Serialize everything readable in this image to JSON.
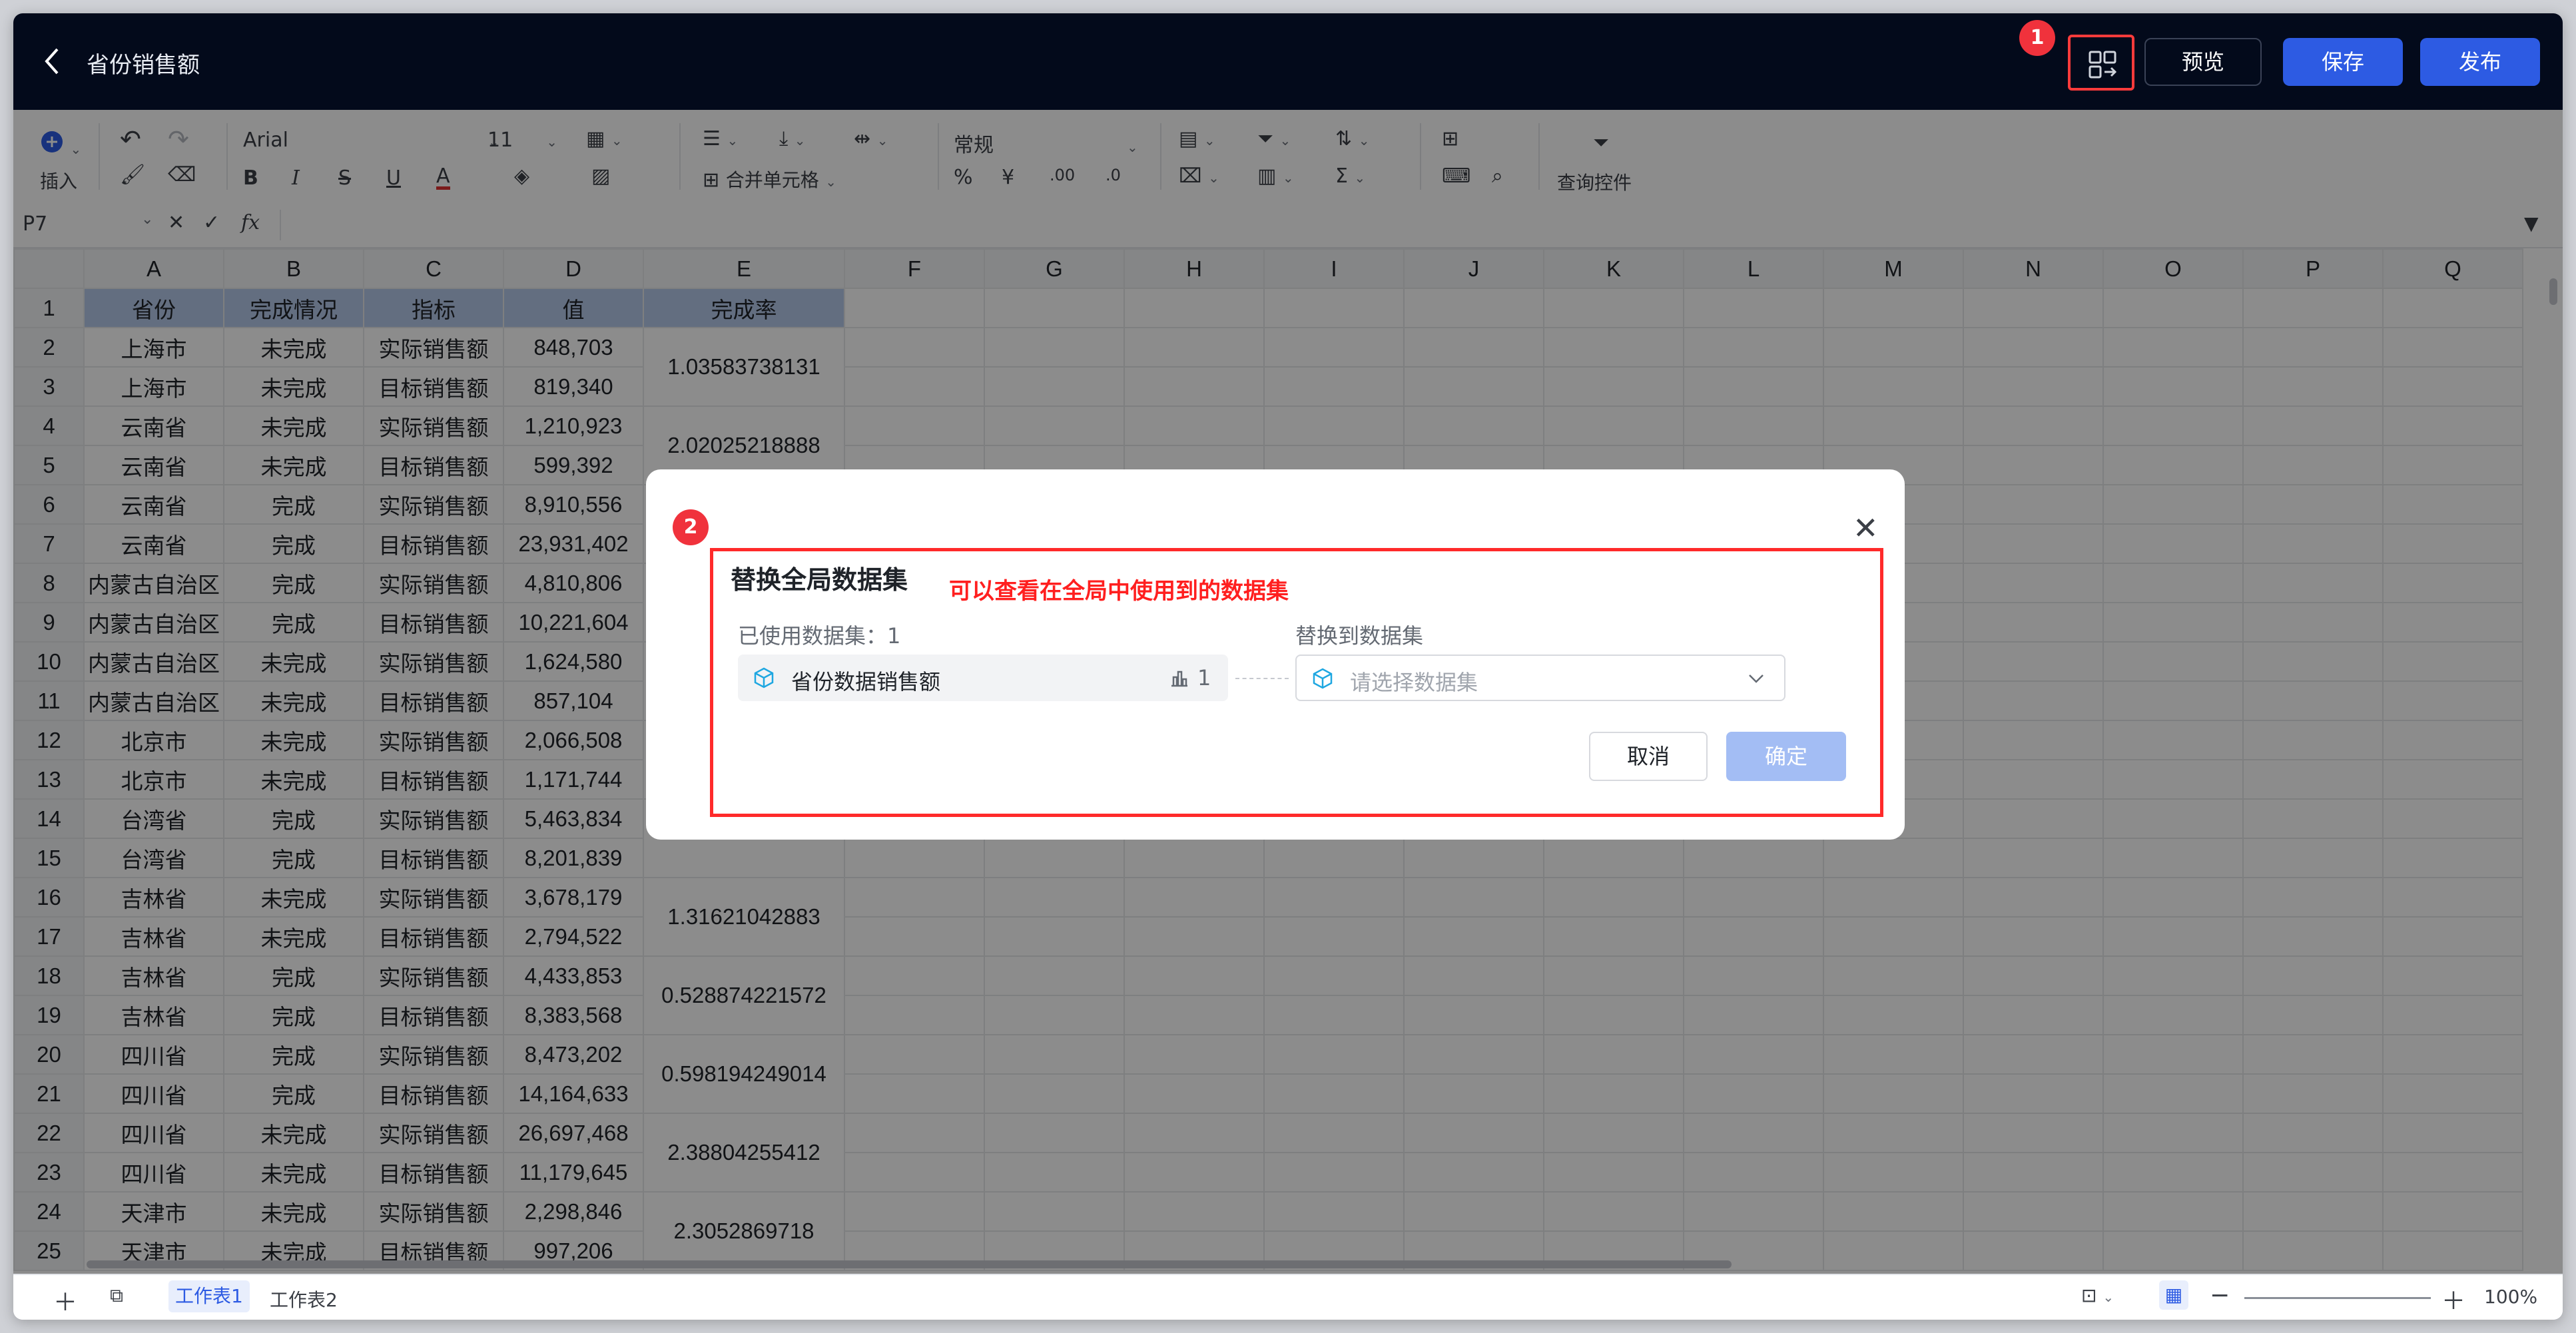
{
  "header": {
    "title": "省份销售额",
    "preview_label": "预览",
    "save_label": "保存",
    "publish_label": "发布"
  },
  "badges": {
    "one": "1",
    "two": "2"
  },
  "toolbar": {
    "insert_label": "插入",
    "font_name": "Arial",
    "font_size": "11",
    "number_format": "常规",
    "merge_label": "合并单元格",
    "query_label": "查询控件",
    "fx_label": "fx"
  },
  "formula": {
    "cell_ref": "P7"
  },
  "sheet": {
    "col_letters": [
      "A",
      "B",
      "C",
      "D",
      "E",
      "F",
      "G",
      "H",
      "I",
      "J",
      "K",
      "L",
      "M",
      "N",
      "O",
      "P",
      "Q"
    ],
    "header_row": [
      "省份",
      "完成情况",
      "指标",
      "值",
      "完成率"
    ],
    "rows": [
      [
        "上海市",
        "未完成",
        "实际销售额",
        "848,703"
      ],
      [
        "上海市",
        "未完成",
        "目标销售额",
        "819,340"
      ],
      [
        "云南省",
        "未完成",
        "实际销售额",
        "1,210,923"
      ],
      [
        "云南省",
        "未完成",
        "目标销售额",
        "599,392"
      ],
      [
        "云南省",
        "完成",
        "实际销售额",
        "8,910,556"
      ],
      [
        "云南省",
        "完成",
        "目标销售额",
        "23,931,402"
      ],
      [
        "内蒙古自治区",
        "完成",
        "实际销售额",
        "4,810,806"
      ],
      [
        "内蒙古自治区",
        "完成",
        "目标销售额",
        "10,221,604"
      ],
      [
        "内蒙古自治区",
        "未完成",
        "实际销售额",
        "1,624,580"
      ],
      [
        "内蒙古自治区",
        "未完成",
        "目标销售额",
        "857,104"
      ],
      [
        "北京市",
        "未完成",
        "实际销售额",
        "2,066,508"
      ],
      [
        "北京市",
        "未完成",
        "目标销售额",
        "1,171,744"
      ],
      [
        "台湾省",
        "完成",
        "实际销售额",
        "5,463,834"
      ],
      [
        "台湾省",
        "完成",
        "目标销售额",
        "8,201,839"
      ],
      [
        "吉林省",
        "未完成",
        "实际销售额",
        "3,678,179"
      ],
      [
        "吉林省",
        "未完成",
        "目标销售额",
        "2,794,522"
      ],
      [
        "吉林省",
        "完成",
        "实际销售额",
        "4,433,853"
      ],
      [
        "吉林省",
        "完成",
        "目标销售额",
        "8,383,568"
      ],
      [
        "四川省",
        "完成",
        "实际销售额",
        "8,473,202"
      ],
      [
        "四川省",
        "完成",
        "目标销售额",
        "14,164,633"
      ],
      [
        "四川省",
        "未完成",
        "实际销售额",
        "26,697,468"
      ],
      [
        "四川省",
        "未完成",
        "目标销售额",
        "11,179,645"
      ],
      [
        "天津市",
        "未完成",
        "实际销售额",
        "2,298,846"
      ],
      [
        "天津市",
        "未完成",
        "目标销售额",
        "997,206"
      ]
    ],
    "rates": [
      "1.03583738131",
      "2.02025218888",
      "",
      "",
      "",
      "",
      "",
      "1.31621042883",
      "0.528874221572",
      "0.598194249014",
      "2.38804255412",
      "2.3052869718"
    ]
  },
  "status": {
    "sheet1": "工作表1",
    "sheet2": "工作表2",
    "zoom": "100%"
  },
  "modal": {
    "title": "替换全局数据集",
    "note": "可以查看在全局中使用到的数据集",
    "used_label": "已使用数据集：1",
    "replace_label": "替换到数据集",
    "dataset_name": "省份数据销售额",
    "dataset_count": "1",
    "select_placeholder": "请选择数据集",
    "cancel_label": "取消",
    "ok_label": "确定"
  }
}
